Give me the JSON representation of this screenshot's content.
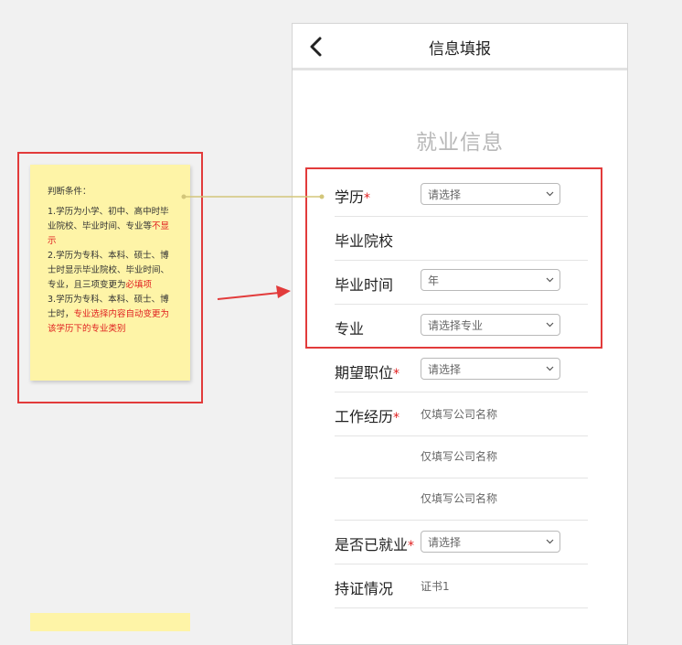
{
  "header": {
    "title": "信息填报",
    "back_icon": "chevron-left-icon"
  },
  "section": {
    "title": "就业信息"
  },
  "form": {
    "education": {
      "label": "学历",
      "required": "*",
      "placeholder": "请选择"
    },
    "school": {
      "label": "毕业院校"
    },
    "grad_time": {
      "label": "毕业时间",
      "value": "年"
    },
    "major": {
      "label": "专业",
      "placeholder": "请选择专业"
    },
    "position": {
      "label": "期望职位",
      "required": "*",
      "placeholder": "请选择"
    },
    "work": {
      "label": "工作经历",
      "required": "*",
      "companies": [
        "仅填写公司名称",
        "仅填写公司名称",
        "仅填写公司名称"
      ]
    },
    "employed": {
      "label": "是否已就业",
      "required": "*",
      "placeholder": "请选择"
    },
    "cert": {
      "label": "持证情况",
      "value": "证书1"
    }
  },
  "note": {
    "heading": "判断条件：",
    "r1_text": "1.学历为小学、初中、高中时毕业院校、毕业时间、专业等",
    "r1_red": "不显示",
    "r2_text": "2.学历为专科、本科、硕士、博士时显示毕业院校、毕业时间、专业，且三项变更为",
    "r2_red": "必填项",
    "r3_text": "3.学历为专科、本科、硕士、博士时，",
    "r3_red": "专业选择内容自动变更为该学历下的专业类别"
  },
  "colors": {
    "annotation_red": "#e23b3b",
    "note_yellow": "#fef4a7",
    "connector": "#d3c67a"
  }
}
